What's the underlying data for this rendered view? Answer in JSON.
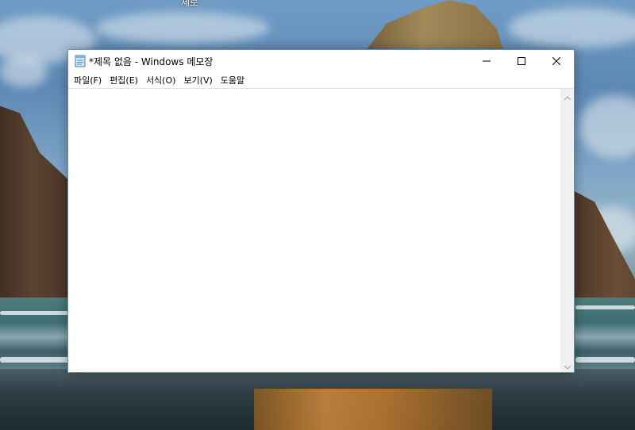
{
  "desktop": {
    "partial_label": "제로"
  },
  "window": {
    "title": "*제목 없음 - Windows 메모장",
    "icon": "notepad-icon",
    "controls": {
      "minimize": "minimize-icon",
      "maximize": "maximize-icon",
      "close": "close-icon"
    }
  },
  "menu": {
    "items": [
      {
        "label": "파일(F)"
      },
      {
        "label": "편집(E)"
      },
      {
        "label": "서식(O)"
      },
      {
        "label": "보기(V)"
      },
      {
        "label": "도움말"
      }
    ]
  },
  "editor": {
    "content": ""
  },
  "colors": {
    "window_border": "#6b8bab",
    "scrollbar_track": "#f0f0f0"
  }
}
